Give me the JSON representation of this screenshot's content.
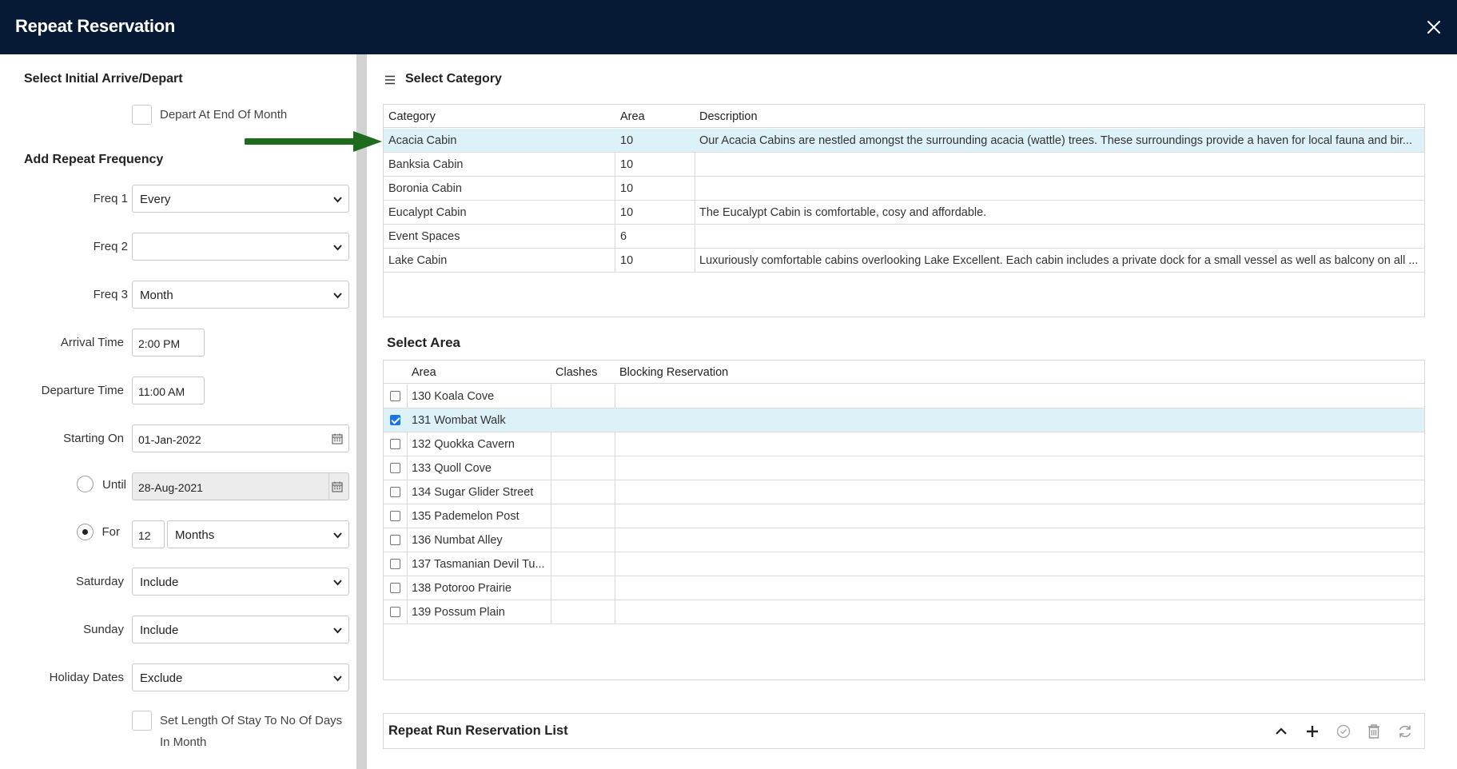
{
  "window": {
    "title": "Repeat Reservation"
  },
  "left": {
    "initial_title": "Select Initial Arrive/Depart",
    "depart_end_of_month": "Depart At End Of Month",
    "repeat_title": "Add Repeat Frequency",
    "freq1": {
      "label": "Freq 1",
      "value": "Every"
    },
    "freq2": {
      "label": "Freq 2",
      "value": ""
    },
    "freq3": {
      "label": "Freq 3",
      "value": "Month"
    },
    "arrival_time": {
      "label": "Arrival Time",
      "value": "2:00 PM"
    },
    "departure_time": {
      "label": "Departure Time",
      "value": "11:00 AM"
    },
    "starting_on": {
      "label": "Starting On",
      "value": "01-Jan-2022"
    },
    "until": {
      "label": "Until",
      "value": "28-Aug-2021",
      "selected": false
    },
    "for": {
      "label": "For",
      "count": "12",
      "unit": "Months",
      "selected": true
    },
    "saturday": {
      "label": "Saturday",
      "value": "Include"
    },
    "sunday": {
      "label": "Sunday",
      "value": "Include"
    },
    "holiday": {
      "label": "Holiday Dates",
      "value": "Exclude"
    },
    "length_of_stay": {
      "line1": "Set Length Of Stay To No Of Days",
      "line2": "In Month"
    }
  },
  "category": {
    "title": "Select Category",
    "headers": [
      "Category",
      "Area",
      "Description"
    ],
    "rows": [
      {
        "category": "Acacia Cabin",
        "area": "10",
        "description": "Our Acacia Cabins are nestled amongst the surrounding acacia (wattle) trees. These surroundings provide a haven for local fauna and bir..."
      },
      {
        "category": "Banksia Cabin",
        "area": "10",
        "description": ""
      },
      {
        "category": "Boronia Cabin",
        "area": "10",
        "description": ""
      },
      {
        "category": "Eucalypt Cabin",
        "area": "10",
        "description": "The Eucalypt Cabin is comfortable, cosy and affordable."
      },
      {
        "category": "Event Spaces",
        "area": "6",
        "description": ""
      },
      {
        "category": "Lake Cabin",
        "area": "10",
        "description": "Luxuriously comfortable cabins overlooking Lake Excellent. Each cabin includes a private dock for a small vessel as well as balcony on all ..."
      }
    ]
  },
  "area": {
    "title": "Select Area",
    "headers": [
      "Area",
      "Clashes",
      "Blocking Reservation"
    ],
    "rows": [
      {
        "area": "130 Koala Cove",
        "checked": false
      },
      {
        "area": "131 Wombat Walk",
        "checked": true
      },
      {
        "area": "132 Quokka Cavern",
        "checked": false
      },
      {
        "area": "133 Quoll Cove",
        "checked": false
      },
      {
        "area": "134 Sugar Glider Street",
        "checked": false
      },
      {
        "area": "135 Pademelon Post",
        "checked": false
      },
      {
        "area": "136 Numbat Alley",
        "checked": false
      },
      {
        "area": "137 Tasmanian Devil Tu...",
        "checked": false
      },
      {
        "area": "138 Potoroo Prairie",
        "checked": false
      },
      {
        "area": "139 Possum Plain",
        "checked": false
      }
    ]
  },
  "repeat_list": {
    "title": "Repeat Run Reservation List"
  },
  "colors": {
    "titlebar": "#061a35",
    "selected_row": "#ddf1f8",
    "pointer_arrow": "#1e6b1e"
  }
}
